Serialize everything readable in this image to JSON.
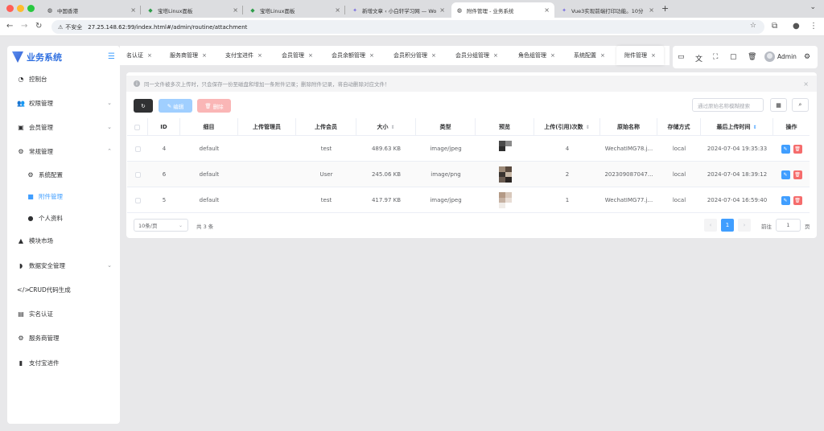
{
  "browser": {
    "tabs": [
      {
        "title": "中国香港",
        "icon": "globe-icon"
      },
      {
        "title": "宝塔Linux面板",
        "icon": "bt-shield-icon"
      },
      {
        "title": "宝塔Linux面板",
        "icon": "bt-shield-icon"
      },
      {
        "title": "新增文章 ‹ 小白轩学习网 — Wo",
        "icon": "wordpress-icon"
      },
      {
        "title": "附件管理 - 业务系统",
        "icon": "globe-icon"
      },
      {
        "title": "Vue3实现前端打印功能。10分",
        "icon": "sparkle-icon"
      }
    ],
    "address": {
      "insecure_label": "不安全",
      "url": "27.25.148.62:99/index.html#/admin/routine/attachment"
    }
  },
  "sidebar": {
    "logo_text": "业务系统",
    "items": [
      {
        "label": "控制台",
        "icon": "dashboard-icon"
      },
      {
        "label": "权限管理",
        "icon": "users-icon"
      },
      {
        "label": "会员管理",
        "icon": "id-card-icon"
      },
      {
        "label": "常规管理",
        "icon": "gears-icon"
      },
      {
        "label": "系统配置",
        "icon": "gear-icon"
      },
      {
        "label": "附件管理",
        "icon": "folder-icon"
      },
      {
        "label": "个人资料",
        "icon": "user-icon"
      },
      {
        "label": "模块市场",
        "icon": "shop-icon"
      },
      {
        "label": "数据安全管理",
        "icon": "shield-icon"
      },
      {
        "label": "CRUD代码生成",
        "icon": "code-icon"
      },
      {
        "label": "实名认证",
        "icon": "id-badge-icon"
      },
      {
        "label": "服务商管理",
        "icon": "gear-icon"
      },
      {
        "label": "支付宝进件",
        "icon": "bar-chart-icon"
      }
    ]
  },
  "navtabs": [
    "名认证",
    "服务商管理",
    "支付宝进件",
    "会员管理",
    "会员余额管理",
    "会员积分管理",
    "会员分组管理",
    "角色组管理",
    "系统配置",
    "附件管理"
  ],
  "header": {
    "admin_name": "Admin"
  },
  "notice": "同一文件被多次上传时，只会保存一份至磁盘和增加一条附件记录；删除附件记录，将自动删除对应文件！",
  "toolbar": {
    "edit_label": "编辑",
    "delete_label": "删除",
    "search_placeholder": "通过原始名称模糊搜索"
  },
  "table": {
    "columns": [
      "ID",
      "细目",
      "上传管理员",
      "上传会员",
      "大小",
      "类型",
      "预览",
      "上传(引用)次数",
      "原始名称",
      "存储方式",
      "最后上传时间",
      "操作"
    ],
    "rows": [
      {
        "id": "4",
        "topic": "default",
        "admin": "",
        "member": "test",
        "size": "489.63 KB",
        "type": "image/jpeg",
        "count": "4",
        "name": "WechatIMG78.j...",
        "storage": "local",
        "time": "2024-07-04 19:35:33"
      },
      {
        "id": "6",
        "topic": "default",
        "admin": "",
        "member": "User",
        "size": "245.06 KB",
        "type": "image/png",
        "count": "2",
        "name": "202309087047...",
        "storage": "local",
        "time": "2024-07-04 18:39:12"
      },
      {
        "id": "5",
        "topic": "default",
        "admin": "",
        "member": "test",
        "size": "417.97 KB",
        "type": "image/jpeg",
        "count": "1",
        "name": "WechatIMG77.j...",
        "storage": "local",
        "time": "2024-07-04 16:59:40"
      }
    ]
  },
  "pagination": {
    "page_size": "10条/页",
    "total": "共 3 条",
    "current": "1",
    "goto_label": "前往",
    "goto_value": "1",
    "goto_suffix": "页"
  }
}
